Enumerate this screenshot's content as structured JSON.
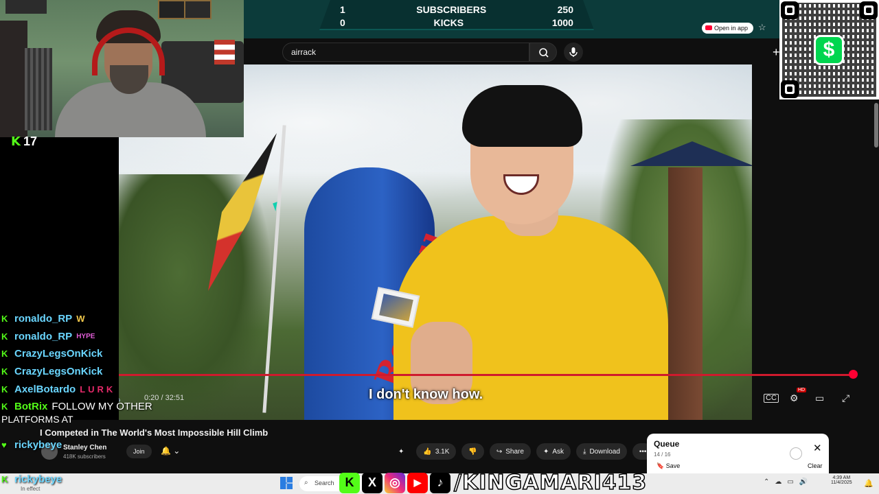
{
  "overlay": {
    "subscribers_label": "SUBSCRIBERS",
    "subscribers_current": "1",
    "subscribers_goal": "250",
    "kicks_label": "KICKS",
    "kicks_current": "0",
    "kicks_goal": "1000",
    "kick_followers": "17"
  },
  "youtube": {
    "open_in_app": "Open in app",
    "search_value": "airrack",
    "video_caption": "I don't know how.",
    "time": "0:20 / 32:51",
    "hd_badge": "HD",
    "video_title": "I Competed in The World's Most Impossible Hill Climb",
    "channel_name": "Stanley Chen",
    "channel_subs": "418K subscribers",
    "join_label": "Join",
    "likes": "3.1K",
    "share_label": "Share",
    "ask_label": "Ask",
    "download_label": "Download"
  },
  "queue": {
    "title": "Queue",
    "count": "14 / 16",
    "save_label": "Save",
    "clear_label": "Clear"
  },
  "chat": {
    "messages": [
      {
        "user": "ronaldo_RP",
        "badge": "W",
        "text": ""
      },
      {
        "user": "ronaldo_RP",
        "badge": "HYPE",
        "text": ""
      },
      {
        "user": "CrazyLegsOnKick",
        "badge": "",
        "text": ""
      },
      {
        "user": "CrazyLegsOnKick",
        "badge": "",
        "text": ""
      },
      {
        "user": "AxelBotardo",
        "badge": "LURK",
        "text": ""
      },
      {
        "user": "BotRix",
        "badge": "",
        "text": "FOLLOW MY OTHER"
      }
    ],
    "continuation": "PLATFORMS AT",
    "extra_user": "rickybeye",
    "last_user": "rickybeye"
  },
  "social": {
    "handle": "/KINGAMARI413",
    "tiktok_label": "TikTok"
  },
  "cashapp_symbol": "$",
  "taskbar": {
    "weather_line1": "",
    "weather_line2": "In effect",
    "search_label": "Search",
    "time": "4:39 AM",
    "date": "11/4/2025"
  },
  "colors": {
    "kick_green": "#53fc18",
    "youtube_red": "#ff0033",
    "overlay_teal": "#0c3b3a"
  }
}
